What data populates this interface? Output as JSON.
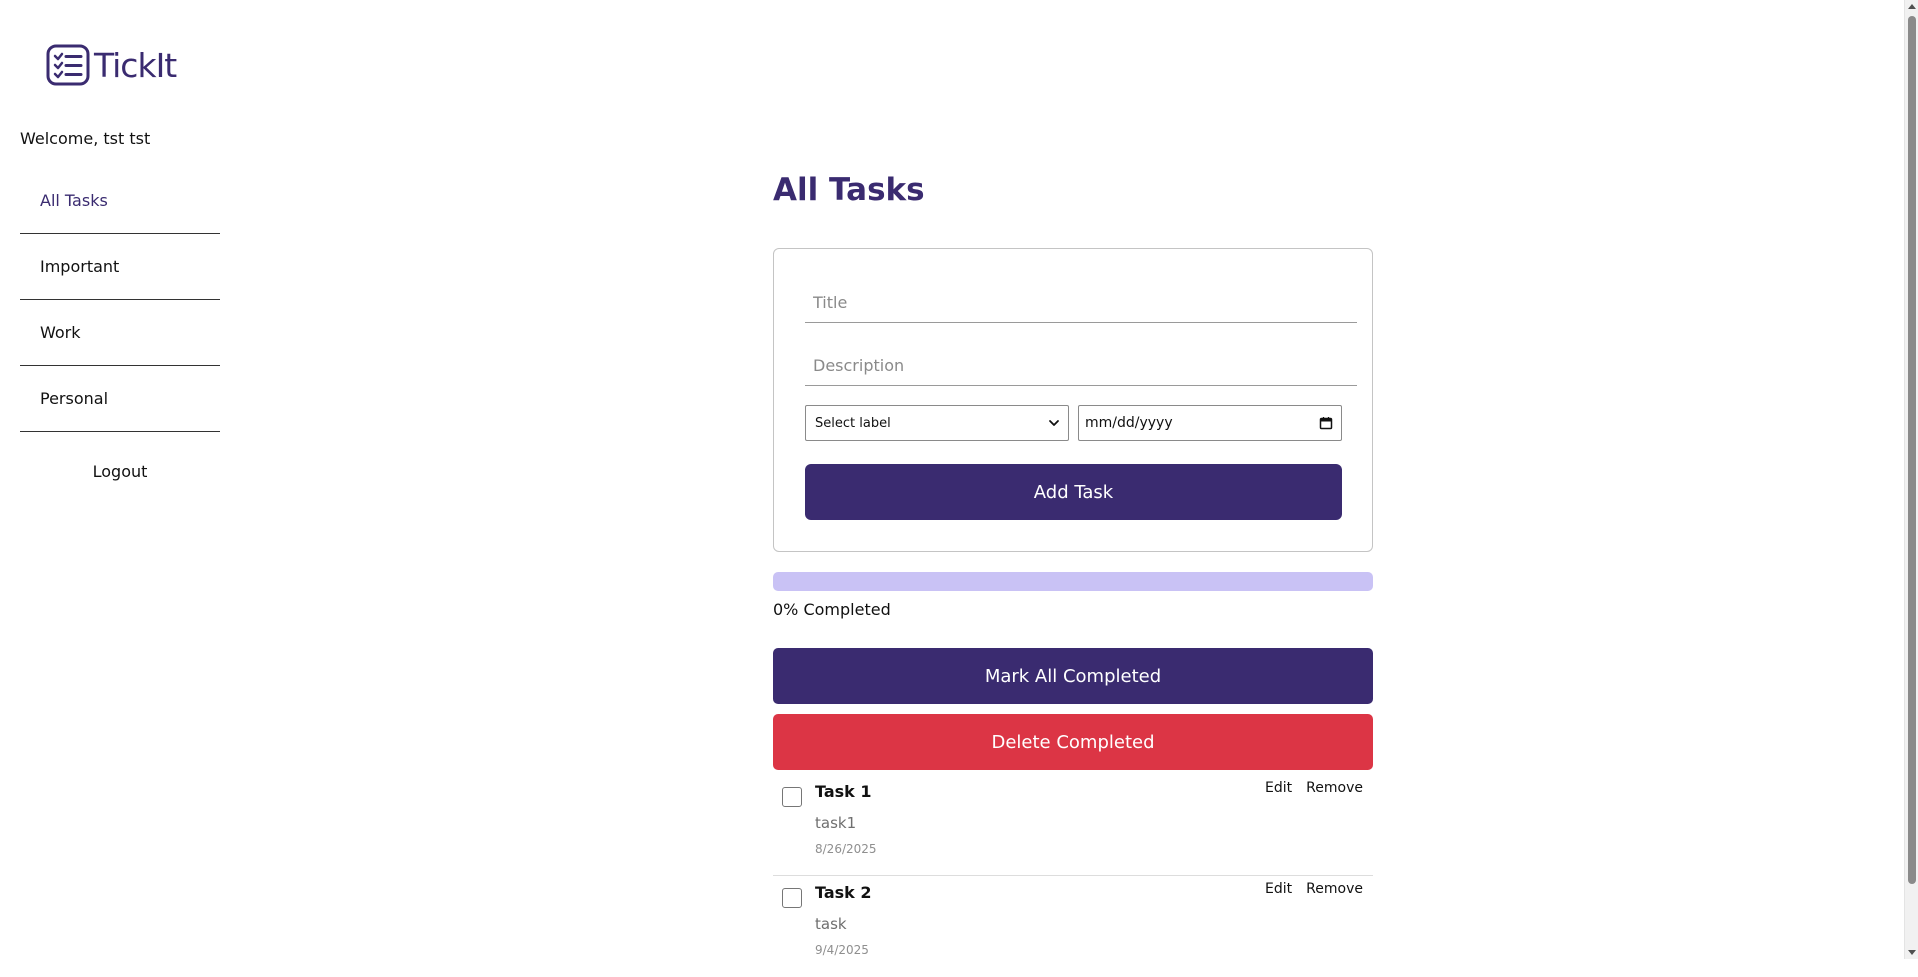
{
  "app": {
    "logo_text": "TickIt",
    "logo_icon": "checklist-icon",
    "brand_color": "#3a2b70"
  },
  "sidebar": {
    "welcome": "Welcome, tst tst",
    "items": [
      {
        "label": "All Tasks",
        "active": true
      },
      {
        "label": "Important",
        "active": false
      },
      {
        "label": "Work",
        "active": false
      },
      {
        "label": "Personal",
        "active": false
      }
    ],
    "logout": "Logout"
  },
  "main": {
    "title": "All Tasks",
    "form": {
      "title_placeholder": "Title",
      "title_value": "",
      "description_placeholder": "Description",
      "description_value": "",
      "label_select": "Select label",
      "date_placeholder": "mm/dd/yyyy",
      "add_button": "Add Task"
    },
    "progress": {
      "percent": 0,
      "label": "0% Completed",
      "track_color": "#c9c2f5"
    },
    "actions": {
      "mark_all": "Mark All Completed",
      "delete_completed": "Delete Completed",
      "danger_color": "#dc3545"
    },
    "tasks": [
      {
        "title": "Task 1",
        "description": "task1",
        "date": "8/26/2025",
        "completed": false,
        "edit": "Edit",
        "remove": "Remove"
      },
      {
        "title": "Task 2",
        "description": "task",
        "date": "9/4/2025",
        "completed": false,
        "edit": "Edit",
        "remove": "Remove"
      }
    ]
  }
}
